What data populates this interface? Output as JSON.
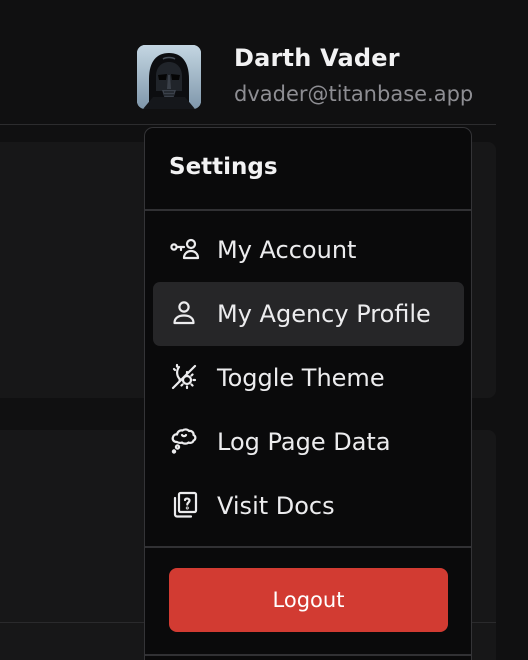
{
  "user": {
    "name": "Darth Vader",
    "email": "dvader@titanbase.app",
    "avatar_icon": "darth-vader-helmet"
  },
  "menu": {
    "title": "Settings",
    "items": [
      {
        "label": "My Account",
        "icon": "user-key-icon"
      },
      {
        "label": "My Agency Profile",
        "icon": "user-icon",
        "active": true
      },
      {
        "label": "Toggle Theme",
        "icon": "sun-moon-icon"
      },
      {
        "label": "Log Page Data",
        "icon": "thought-bubble-icon"
      },
      {
        "label": "Visit Docs",
        "icon": "help-book-icon"
      }
    ],
    "logout_label": "Logout"
  },
  "colors": {
    "background": "#101011",
    "menu_background": "#0a0a0b",
    "active_item": "#262628",
    "logout_button": "#d23b32",
    "email_text": "#8e8e93"
  }
}
